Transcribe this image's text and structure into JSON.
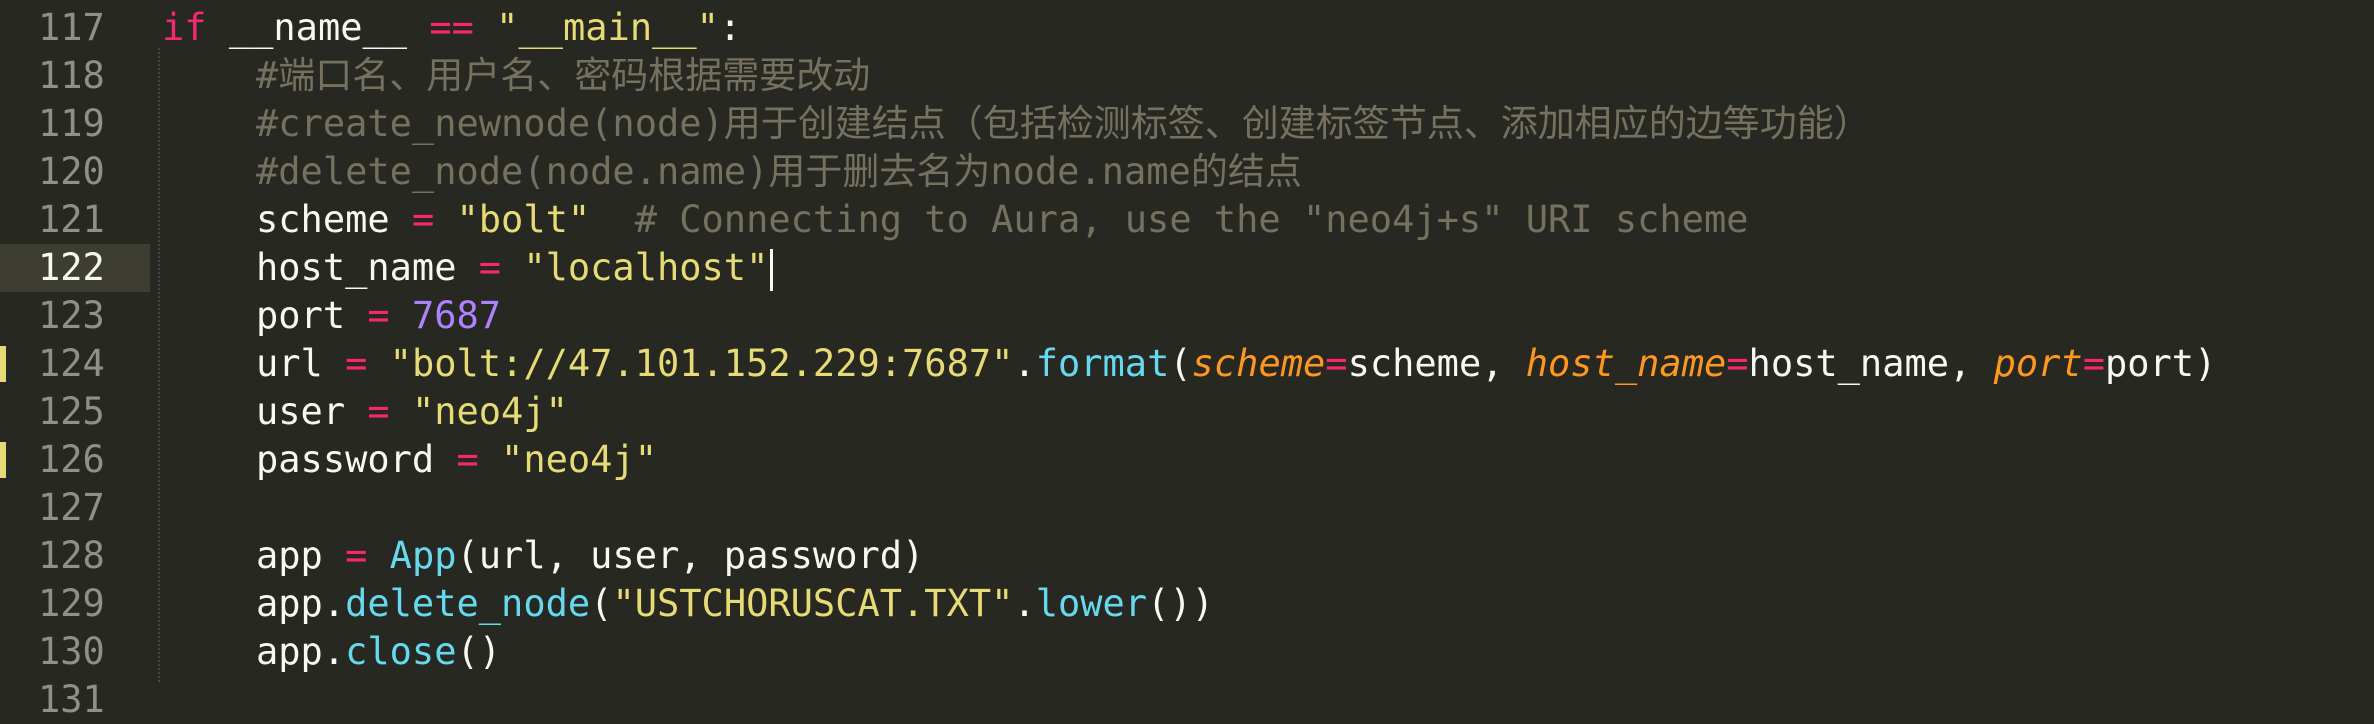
{
  "editor": {
    "theme_colors": {
      "background": "#272822",
      "keyword": "#f92672",
      "string": "#e6db74",
      "number": "#ae81ff",
      "comment": "#75715e",
      "function": "#66d9ef",
      "parameter": "#fd971f",
      "text": "#f8f8f2",
      "modified_marker": "#e6db74"
    },
    "active_line": "122",
    "lines": [
      {
        "num": "117",
        "t": {
          "a": "if",
          "b": " __name__ ",
          "c": "==",
          "d": " ",
          "e": "\"__main__\"",
          "f": ":"
        }
      },
      {
        "num": "118",
        "t": {
          "a": "#端口名、用户名、密码根据需要改动"
        }
      },
      {
        "num": "119",
        "t": {
          "a": "#create_newnode(node)用于创建结点（包括检测标签、创建标签节点、添加相应的边等功能）"
        }
      },
      {
        "num": "120",
        "t": {
          "a": "#delete_node(node.name)用于删去名为node.name的结点"
        }
      },
      {
        "num": "121",
        "t": {
          "a": "scheme ",
          "b": "=",
          "c": " ",
          "d": "\"bolt\"",
          "e": "  # Connecting to Aura, use the \"neo4j+s\" URI scheme"
        }
      },
      {
        "num": "122",
        "t": {
          "a": "host_name ",
          "b": "=",
          "c": " ",
          "d": "\"localhost\""
        }
      },
      {
        "num": "123",
        "t": {
          "a": "port ",
          "b": "=",
          "c": " ",
          "d": "7687"
        }
      },
      {
        "num": "124",
        "t": {
          "a": "url ",
          "b": "=",
          "c": " ",
          "d": "\"bolt://47.101.152.229:7687\"",
          "e": ".",
          "f": "format",
          "g": "(",
          "h": "scheme",
          "i": "=",
          "j": "scheme, ",
          "k": "host_name",
          "l": "=",
          "m": "host_name, ",
          "n": "port",
          "o": "=",
          "p": "port)"
        }
      },
      {
        "num": "125",
        "t": {
          "a": "user ",
          "b": "=",
          "c": " ",
          "d": "\"neo4j\""
        }
      },
      {
        "num": "126",
        "t": {
          "a": "password ",
          "b": "=",
          "c": " ",
          "d": "\"neo4j\""
        }
      },
      {
        "num": "127",
        "t": {}
      },
      {
        "num": "128",
        "t": {
          "a": "app ",
          "b": "=",
          "c": " ",
          "d": "App",
          "e": "(url, user, password)"
        }
      },
      {
        "num": "129",
        "t": {
          "a": "app.",
          "b": "delete_node",
          "c": "(",
          "d": "\"USTCHORUSCAT.TXT\"",
          "e": ".",
          "f": "lower",
          "g": "())"
        }
      },
      {
        "num": "130",
        "t": {
          "a": "app.",
          "b": "close",
          "c": "()"
        }
      },
      {
        "num": "131",
        "t": {}
      }
    ]
  }
}
